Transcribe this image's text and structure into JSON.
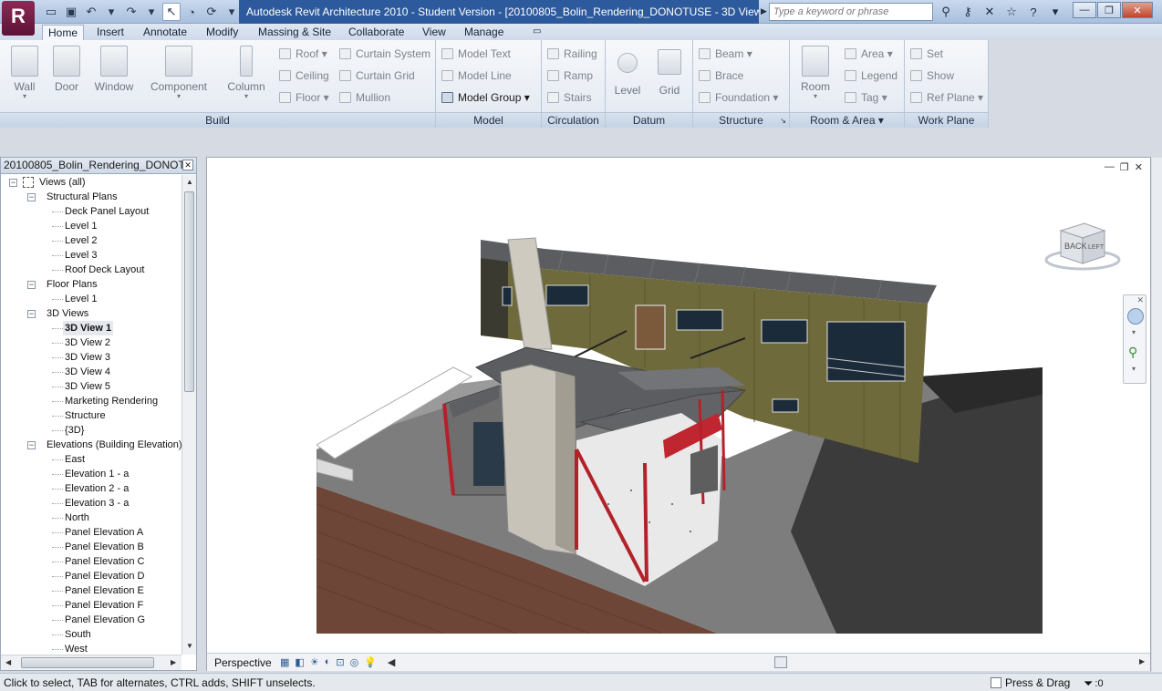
{
  "title_bar": {
    "title": "Autodesk Revit Architecture 2010 - Student Version - [20100805_Bolin_Rendering_DONOTUSE - 3D View: 3D View 1]",
    "search_placeholder": "Type a keyword or phrase",
    "app_letter": "R"
  },
  "ribbon_tabs": [
    "Home",
    "Insert",
    "Annotate",
    "Modify",
    "Massing & Site",
    "Collaborate",
    "View",
    "Manage"
  ],
  "ribbon": {
    "build": {
      "title": "Build",
      "wall": "Wall",
      "door": "Door",
      "window": "Window",
      "component": "Component",
      "column": "Column",
      "roof": "Roof",
      "ceiling": "Ceiling",
      "floor": "Floor",
      "curtain_system": "Curtain System",
      "curtain_grid": "Curtain Grid",
      "mullion": "Mullion"
    },
    "model": {
      "title": "Model",
      "model_text": "Model Text",
      "model_line": "Model Line",
      "model_group": "Model Group"
    },
    "circulation": {
      "title": "Circulation",
      "railing": "Railing",
      "ramp": "Ramp",
      "stairs": "Stairs"
    },
    "datum": {
      "title": "Datum",
      "level": "Level",
      "grid": "Grid"
    },
    "structure": {
      "title": "Structure",
      "beam": "Beam",
      "brace": "Brace",
      "foundation": "Foundation"
    },
    "room_area": {
      "title": "Room & Area",
      "room": "Room",
      "area": "Area",
      "legend": "Legend",
      "tag": "Tag"
    },
    "work_plane": {
      "title": "Work Plane",
      "set": "Set",
      "show": "Show",
      "ref_plane": "Ref Plane"
    }
  },
  "project_browser": {
    "title": "20100805_Bolin_Rendering_DONOT...",
    "root": "Views (all)",
    "structural_plans": {
      "label": "Structural Plans",
      "items": [
        "Deck Panel Layout",
        "Level 1",
        "Level 2",
        "Level 3",
        "Roof Deck Layout"
      ]
    },
    "floor_plans": {
      "label": "Floor Plans",
      "items": [
        "Level 1"
      ]
    },
    "views_3d": {
      "label": "3D Views",
      "items": [
        "3D View 1",
        "3D View 2",
        "3D View 3",
        "3D View 4",
        "3D View 5",
        "Marketing Rendering",
        "Structure",
        "{3D}"
      ]
    },
    "elevations": {
      "label": "Elevations (Building Elevation)",
      "items": [
        "East",
        "Elevation 1 - a",
        "Elevation 2 - a",
        "Elevation 3 - a",
        "North",
        "Panel Elevation A",
        "Panel Elevation B",
        "Panel Elevation C",
        "Panel Elevation D",
        "Panel Elevation E",
        "Panel Elevation F",
        "Panel Elevation G",
        "South",
        "West"
      ]
    },
    "selected": "3D View 1"
  },
  "view": {
    "viewcube_label": "BACK",
    "viewcube_side": "LEFT",
    "scale_label": "Perspective"
  },
  "status_bar": {
    "message": "Click to select, TAB for alternates, CTRL adds, SHIFT unselects.",
    "press_drag": "Press & Drag",
    "filter_count": ":0"
  },
  "colors": {
    "accent": "#2d5a9c",
    "siding": "#6f6a3c",
    "roof": "#5b5d60",
    "chimney": "#c8c3b8",
    "steel": "#b3222a",
    "ground": "#7a7a7a",
    "deck": "#6e4637"
  }
}
